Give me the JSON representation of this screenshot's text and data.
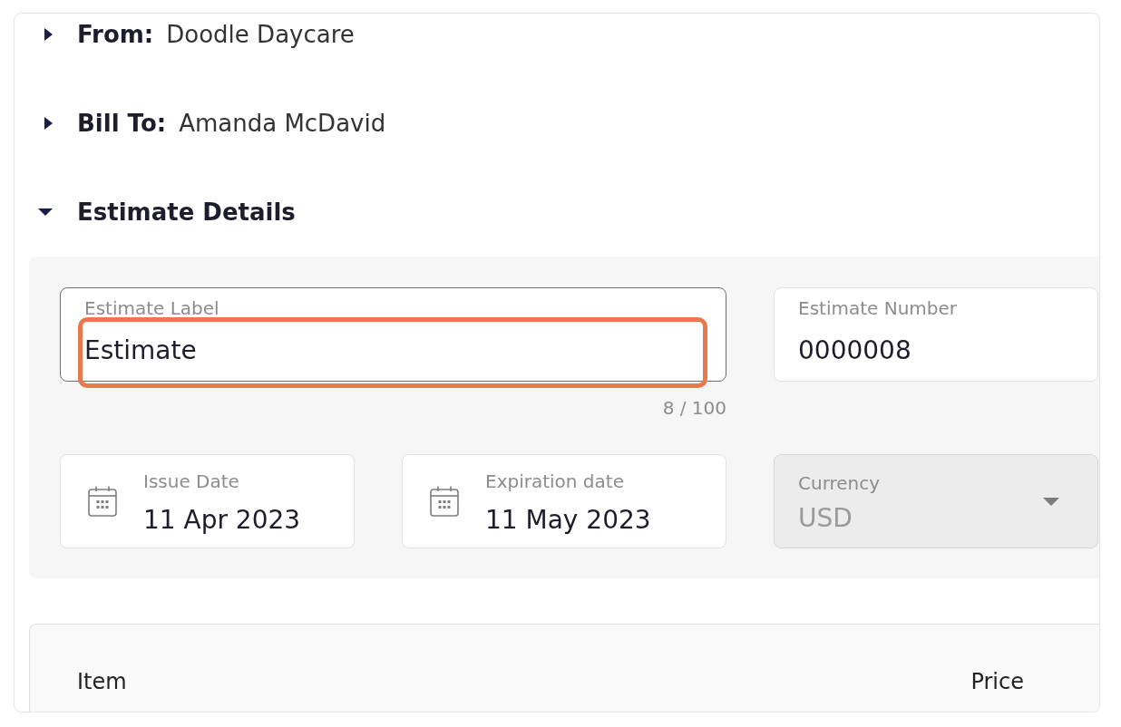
{
  "sections": [
    {
      "label": "From:",
      "value": "Doodle Daycare",
      "expanded": false
    },
    {
      "label": "Bill To:",
      "value": "Amanda McDavid",
      "expanded": false
    },
    {
      "label": "Estimate Details",
      "expanded": true,
      "fields": [
        {
          "kind": "text",
          "label": "Estimate Label",
          "value": "Estimate",
          "focused": true,
          "highlighted": true,
          "counter": "8 / 100"
        },
        {
          "kind": "text",
          "label": "Estimate Number",
          "value": "0000008",
          "focused": false,
          "highlighted": false
        },
        {
          "kind": "date",
          "label": "Issue Date",
          "value": "11 Apr 2023"
        },
        {
          "kind": "date",
          "label": "Expiration date",
          "value": "11 May 2023"
        },
        {
          "kind": "select",
          "label": "Currency",
          "value": "USD",
          "disabled": true
        }
      ]
    }
  ],
  "table": {
    "columns": [
      "Item",
      "Price"
    ]
  }
}
